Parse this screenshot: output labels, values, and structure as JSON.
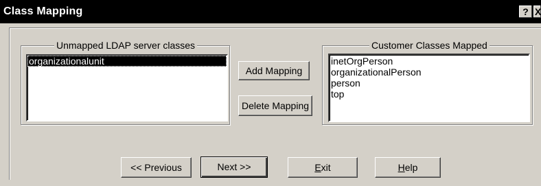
{
  "window": {
    "title": "Class Mapping",
    "help_glyph": "?",
    "close_glyph": "X"
  },
  "unmapped": {
    "legend": "Unmapped LDAP server classes",
    "items": [
      "organizationalunit"
    ],
    "selected_index": 0
  },
  "mapped": {
    "legend": "Customer Classes Mapped",
    "items": [
      "inetOrgPerson",
      "organizationalPerson",
      "person",
      "top"
    ]
  },
  "actions": {
    "add_mapping": "Add Mapping",
    "delete_mapping": "Delete Mapping"
  },
  "nav": {
    "previous": "<< Previous",
    "next": "Next >>",
    "exit_mnemonic": "E",
    "exit_rest": "xit",
    "help_mnemonic": "H",
    "help_rest": "elp"
  }
}
